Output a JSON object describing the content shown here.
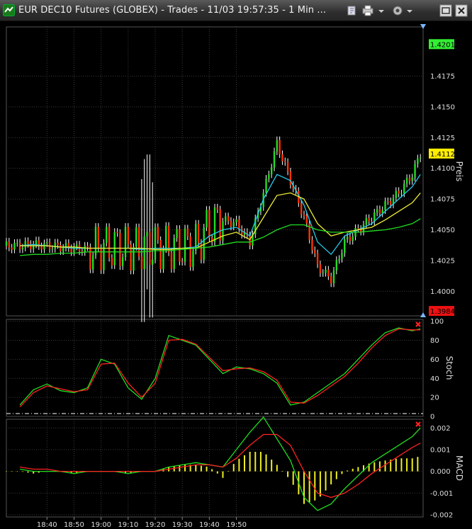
{
  "window": {
    "title": "EUR DEC10 Futures (GLOBEX) - Trades - 11/03 19:57:35 - 1 Min ..."
  },
  "toolbar": {
    "icons": [
      "pin-icon",
      "print-icon",
      "settings-icon",
      "dropdown-icon"
    ],
    "window_buttons": [
      "restore-icon",
      "close-icon"
    ]
  },
  "colors": {
    "background": "#000000",
    "grid": "#3a3a3a",
    "up_candle": "#22dd22",
    "down_candle": "#ff3300",
    "wick": "#ffffff",
    "ma_fast": "#22ccee",
    "ma_mid": "#eeee33",
    "ma_slow": "#22dd22",
    "stoch_k": "#22dd22",
    "stoch_d": "#ff2222",
    "macd_hist": "#eeee22"
  },
  "chart_data": [
    {
      "type": "candlestick",
      "ylabel": "Preis",
      "ylim": [
        1.3984,
        1.4201
      ],
      "yticks": [
        "1.4175",
        "1.4150",
        "1.4125",
        "1.4100",
        "1.4075",
        "1.4050",
        "1.4025",
        "1.4000"
      ],
      "price_badges": [
        {
          "label": "1.4201",
          "color": "#33ee33"
        },
        {
          "label": "1.4112",
          "color": "#ffee00"
        },
        {
          "label": "1.3984",
          "color": "#ee1111"
        }
      ],
      "x_minutes": [
        -90,
        -85,
        -80,
        -75,
        -70,
        -65,
        -60,
        -55,
        -50,
        -45,
        -40,
        -35,
        -30,
        -25,
        -20,
        -15,
        -10,
        -5,
        0,
        5,
        10,
        15,
        20,
        25,
        30,
        35,
        40,
        45,
        50,
        55,
        58
      ],
      "close": [
        1.4037,
        1.4038,
        1.4037,
        1.4036,
        1.4035,
        1.4034,
        1.4035,
        1.4036,
        1.4035,
        1.4034,
        1.4036,
        1.4035,
        1.4036,
        1.4037,
        1.4053,
        1.4058,
        1.4055,
        1.404,
        1.408,
        1.412,
        1.409,
        1.406,
        1.402,
        1.401,
        1.404,
        1.405,
        1.406,
        1.407,
        1.408,
        1.4095,
        1.4112
      ],
      "series": [
        {
          "name": "ma_fast",
          "values": [
            1.4037,
            1.4038,
            1.4037,
            1.4036,
            1.4035,
            1.4035,
            1.4035,
            1.4035,
            1.4035,
            1.4034,
            1.4035,
            1.4035,
            1.4035,
            1.4036,
            1.4045,
            1.405,
            1.4052,
            1.4045,
            1.4075,
            1.4095,
            1.409,
            1.407,
            1.404,
            1.403,
            1.4045,
            1.405,
            1.4055,
            1.4065,
            1.4075,
            1.4085,
            1.4095
          ]
        },
        {
          "name": "ma_mid",
          "values": [
            1.4037,
            1.4037,
            1.4037,
            1.4036,
            1.4036,
            1.4035,
            1.4035,
            1.4035,
            1.4035,
            1.4035,
            1.4034,
            1.4034,
            1.4035,
            1.4035,
            1.404,
            1.4045,
            1.4048,
            1.4042,
            1.406,
            1.4078,
            1.408,
            1.4075,
            1.4055,
            1.4045,
            1.4048,
            1.405,
            1.4052,
            1.4058,
            1.4065,
            1.4072,
            1.408
          ]
        },
        {
          "name": "ma_slow",
          "values": [
            1.4029,
            1.403,
            1.403,
            1.4031,
            1.4031,
            1.4032,
            1.4032,
            1.4032,
            1.4032,
            1.4032,
            1.4033,
            1.4033,
            1.4034,
            1.4035,
            1.4036,
            1.4038,
            1.404,
            1.404,
            1.4044,
            1.405,
            1.4054,
            1.4054,
            1.405,
            1.4048,
            1.4048,
            1.4048,
            1.4049,
            1.405,
            1.4052,
            1.4055,
            1.4059
          ]
        }
      ]
    },
    {
      "type": "line",
      "ylabel": "Stoch",
      "ylim": [
        0,
        100
      ],
      "yticks": [
        "100",
        "80",
        "60",
        "40",
        "20",
        "0"
      ],
      "x_minutes": [
        -90,
        -85,
        -80,
        -75,
        -70,
        -65,
        -60,
        -55,
        -50,
        -45,
        -40,
        -35,
        -30,
        -25,
        -20,
        -15,
        -10,
        -5,
        0,
        5,
        10,
        15,
        20,
        25,
        30,
        35,
        40,
        45,
        50,
        55,
        58
      ],
      "series": [
        {
          "name": "k",
          "values": [
            12,
            28,
            34,
            27,
            25,
            30,
            60,
            55,
            30,
            18,
            40,
            85,
            80,
            75,
            60,
            45,
            52,
            50,
            45,
            35,
            12,
            15,
            25,
            35,
            45,
            60,
            75,
            88,
            93,
            90,
            92
          ]
        },
        {
          "name": "d",
          "values": [
            10,
            25,
            32,
            29,
            26,
            28,
            55,
            56,
            35,
            20,
            35,
            80,
            81,
            76,
            62,
            48,
            50,
            51,
            47,
            38,
            15,
            14,
            22,
            32,
            42,
            56,
            72,
            85,
            92,
            91,
            91
          ]
        }
      ]
    },
    {
      "type": "line",
      "ylabel": "MACD",
      "ylim": [
        -0.0021,
        0.0024
      ],
      "yticks": [
        "0.002",
        "0.001",
        "0.000",
        "-0.001",
        "-0.002"
      ],
      "x_minutes": [
        -90,
        -85,
        -80,
        -75,
        -70,
        -65,
        -60,
        -55,
        -50,
        -45,
        -40,
        -35,
        -30,
        -25,
        -20,
        -15,
        -10,
        -5,
        0,
        5,
        10,
        15,
        20,
        25,
        30,
        35,
        40,
        45,
        50,
        55,
        58
      ],
      "series": [
        {
          "name": "macd",
          "values": [
            0.0001,
            0.0,
            0.0,
            0.0,
            -0.0001,
            0.0,
            0.0,
            0.0,
            -0.0001,
            0.0,
            0.0,
            0.0002,
            0.0003,
            0.0004,
            0.0003,
            0.0002,
            0.001,
            0.0018,
            0.0025,
            0.0015,
            0.0005,
            -0.0012,
            -0.0018,
            -0.0015,
            -0.0008,
            -0.0002,
            0.0004,
            0.0008,
            0.0012,
            0.0016,
            0.002
          ]
        },
        {
          "name": "signal",
          "values": [
            0.0002,
            0.0001,
            0.0001,
            0.0,
            0.0,
            0.0,
            0.0,
            0.0,
            0.0,
            0.0,
            0.0,
            0.0001,
            0.0002,
            0.0003,
            0.0003,
            0.0002,
            0.0006,
            0.0012,
            0.0017,
            0.0017,
            0.0012,
            0.0,
            -0.001,
            -0.0012,
            -0.001,
            -0.0006,
            -0.0001,
            0.0003,
            0.0007,
            0.0011,
            0.0013
          ]
        }
      ],
      "histogram": [
        0.0,
        -0.0001,
        0.0,
        0.0,
        -0.0001,
        0.0,
        0.0,
        0.0,
        -0.0001,
        0.0,
        0.0,
        0.0002,
        0.0003,
        0.0003,
        0.0002,
        -0.0003,
        0.0005,
        0.0009,
        0.0009,
        0.0003,
        -0.0004,
        -0.0015,
        -0.0013,
        -0.0006,
        0.0,
        0.0002,
        0.0004,
        0.0005,
        0.0006,
        0.0006,
        0.0007
      ]
    }
  ],
  "time_axis": {
    "labels": [
      "18:40",
      "18:50",
      "19:00",
      "19:10",
      "19:20",
      "19:30",
      "19:40",
      "19:50"
    ],
    "label_minutes": [
      -80,
      -70,
      -60,
      -50,
      -40,
      -30,
      -20,
      -10
    ]
  }
}
